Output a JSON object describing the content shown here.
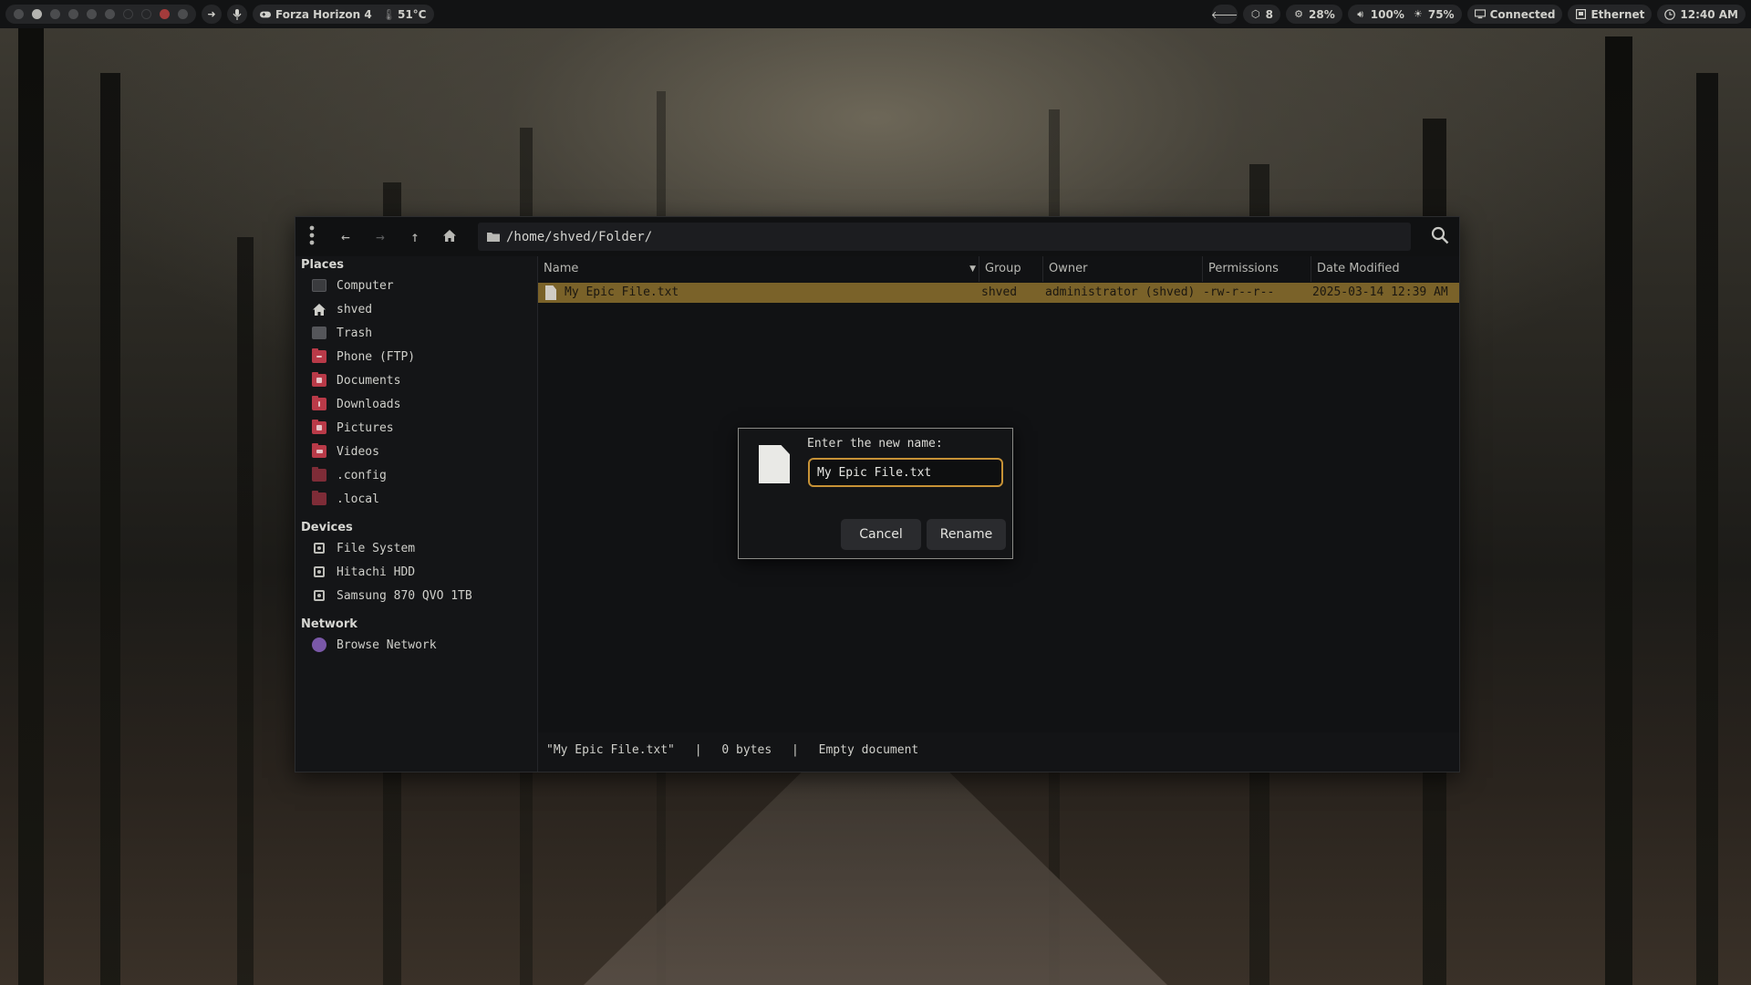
{
  "topbar": {
    "app_title": "Forza Horizon 4",
    "temperature": "51°C",
    "updates": "8",
    "cpu": "28%",
    "volume": "100%",
    "brightness": "75%",
    "network_status": "Connected",
    "network_type": "Ethernet",
    "clock": "12:40 AM",
    "workspaces": [
      "active",
      "normal",
      "normal",
      "normal",
      "normal",
      "normal",
      "empty",
      "empty",
      "urgent",
      "normal"
    ]
  },
  "window": {
    "path": "/home/shved/Folder/",
    "places_header": "Places",
    "places": [
      {
        "label": "Computer",
        "icon": "computer-icon"
      },
      {
        "label": "shved",
        "icon": "home-icon"
      },
      {
        "label": "Trash",
        "icon": "trash-icon"
      },
      {
        "label": "Phone (FTP)",
        "icon": "folder-icon"
      },
      {
        "label": "Documents",
        "icon": "folder-documents-icon"
      },
      {
        "label": "Downloads",
        "icon": "folder-downloads-icon"
      },
      {
        "label": "Pictures",
        "icon": "folder-pictures-icon"
      },
      {
        "label": "Videos",
        "icon": "folder-videos-icon"
      },
      {
        "label": ".config",
        "icon": "folder-icon"
      },
      {
        "label": ".local",
        "icon": "folder-icon"
      }
    ],
    "devices_header": "Devices",
    "devices": [
      {
        "label": "File System",
        "icon": "drive-icon"
      },
      {
        "label": "Hitachi HDD",
        "icon": "drive-icon"
      },
      {
        "label": "Samsung 870 QVO 1TB",
        "icon": "drive-icon"
      }
    ],
    "network_header": "Network",
    "network": [
      {
        "label": "Browse Network",
        "icon": "network-icon"
      }
    ],
    "columns": {
      "name": "Name",
      "group": "Group",
      "owner": "Owner",
      "permissions": "Permissions",
      "date_modified": "Date Modified"
    },
    "files": [
      {
        "name": "My Epic File.txt",
        "group": "shved",
        "owner": "administrator (shved)",
        "permissions": "-rw-r--r--",
        "date_modified": "2025-03-14 12:39 AM"
      }
    ],
    "status": {
      "filename": "\"My Epic File.txt\"",
      "separator": "|",
      "size": "0 bytes",
      "type": "Empty document"
    }
  },
  "dialog": {
    "prompt": "Enter the new name:",
    "input_value": "My Epic File.txt",
    "cancel_label": "Cancel",
    "rename_label": "Rename"
  },
  "colors": {
    "selection": "#7a6229",
    "input_border": "#c79236",
    "folder_red": "#b93a48"
  }
}
